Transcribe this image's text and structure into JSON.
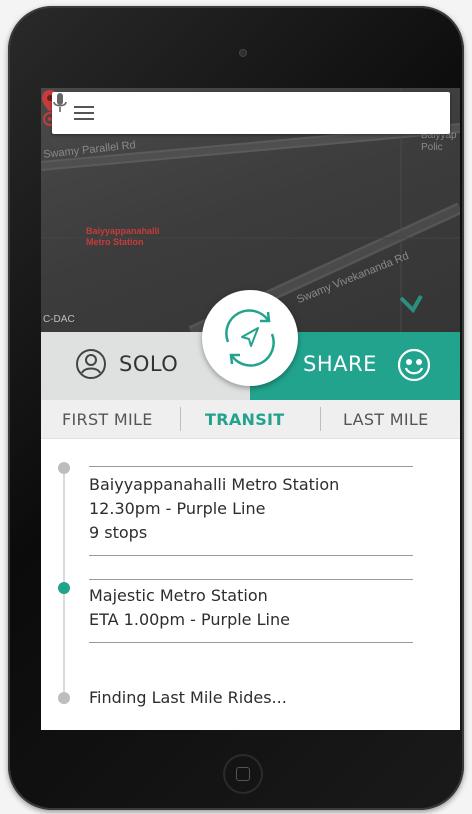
{
  "map": {
    "roads": [
      "Swamy Parallel Rd",
      "Swamy Vivekananda Rd"
    ],
    "corner_label": "Baiyyap Polic",
    "pin_label": [
      "Baiyyappanahalli",
      "Metro Station"
    ],
    "cdac_label": "C-DAC"
  },
  "search": {
    "menu_icon": "hamburger-menu-icon",
    "mic_icon": "microphone-icon"
  },
  "mode": {
    "solo_label": "SOLO",
    "share_label": "SHARE",
    "selected": "SHARE",
    "accent_color": "#22a38e"
  },
  "tabs": [
    {
      "label": "FIRST MILE",
      "active": false
    },
    {
      "label": "TRANSIT",
      "active": true
    },
    {
      "label": "LAST MILE",
      "active": false
    }
  ],
  "itinerary": [
    {
      "lines": [
        "Baiyyappanahalli Metro Station",
        "12.30pm - Purple Line",
        "9 stops"
      ],
      "active": false
    },
    {
      "lines": [
        "Majestic Metro Station",
        "ETA 1.00pm - Purple Line"
      ],
      "active": true
    },
    {
      "lines": [
        "Finding Last Mile Rides..."
      ],
      "active": false
    }
  ]
}
